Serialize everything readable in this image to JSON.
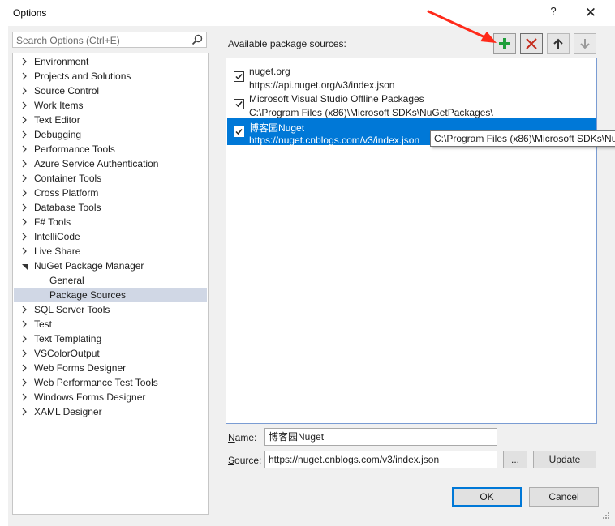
{
  "window": {
    "title": "Options",
    "help_label": "?",
    "close_label": "✕"
  },
  "search": {
    "placeholder": "Search Options (Ctrl+E)"
  },
  "tree": {
    "items": [
      {
        "label": "Environment",
        "expanded": false
      },
      {
        "label": "Projects and Solutions",
        "expanded": false
      },
      {
        "label": "Source Control",
        "expanded": false
      },
      {
        "label": "Work Items",
        "expanded": false
      },
      {
        "label": "Text Editor",
        "expanded": false
      },
      {
        "label": "Debugging",
        "expanded": false
      },
      {
        "label": "Performance Tools",
        "expanded": false
      },
      {
        "label": "Azure Service Authentication",
        "expanded": false
      },
      {
        "label": "Container Tools",
        "expanded": false
      },
      {
        "label": "Cross Platform",
        "expanded": false
      },
      {
        "label": "Database Tools",
        "expanded": false
      },
      {
        "label": "F# Tools",
        "expanded": false
      },
      {
        "label": "IntelliCode",
        "expanded": false
      },
      {
        "label": "Live Share",
        "expanded": false
      },
      {
        "label": "NuGet Package Manager",
        "expanded": true
      },
      {
        "label": "General",
        "child": true
      },
      {
        "label": "Package Sources",
        "child": true,
        "selected": true
      },
      {
        "label": "SQL Server Tools",
        "expanded": false
      },
      {
        "label": "Test",
        "expanded": false
      },
      {
        "label": "Text Templating",
        "expanded": false
      },
      {
        "label": "VSColorOutput",
        "expanded": false
      },
      {
        "label": "Web Forms Designer",
        "expanded": false
      },
      {
        "label": "Web Performance Test Tools",
        "expanded": false
      },
      {
        "label": "Windows Forms Designer",
        "expanded": false
      },
      {
        "label": "XAML Designer",
        "expanded": false
      }
    ]
  },
  "sources_panel": {
    "heading": "Available package sources:",
    "sources": [
      {
        "name": "nuget.org",
        "url": "https://api.nuget.org/v3/index.json",
        "checked": true
      },
      {
        "name": "Microsoft Visual Studio Offline Packages",
        "url": "C:\\Program Files (x86)\\Microsoft SDKs\\NuGetPackages\\",
        "checked": true
      },
      {
        "name": "博客园Nuget",
        "url": "https://nuget.cnblogs.com/v3/index.json",
        "checked": true,
        "selected": true
      }
    ],
    "tooltip": "C:\\Program Files (x86)\\Microsoft SDKs\\NuGetPackages\\"
  },
  "form": {
    "name_label_first": "N",
    "name_label_rest": "ame:",
    "name_value": "博客园Nuget",
    "source_label_first": "S",
    "source_label_rest": "ource:",
    "source_value": "https://nuget.cnblogs.com/v3/index.json",
    "browse_label": "...",
    "update_label": "Update"
  },
  "footer": {
    "ok_label": "OK",
    "cancel_label": "Cancel"
  },
  "colors": {
    "selection_blue": "#0078d7",
    "add_green": "#1e9e3a",
    "remove_red": "#c42b1c",
    "annotation_red": "#ff2a1a"
  }
}
